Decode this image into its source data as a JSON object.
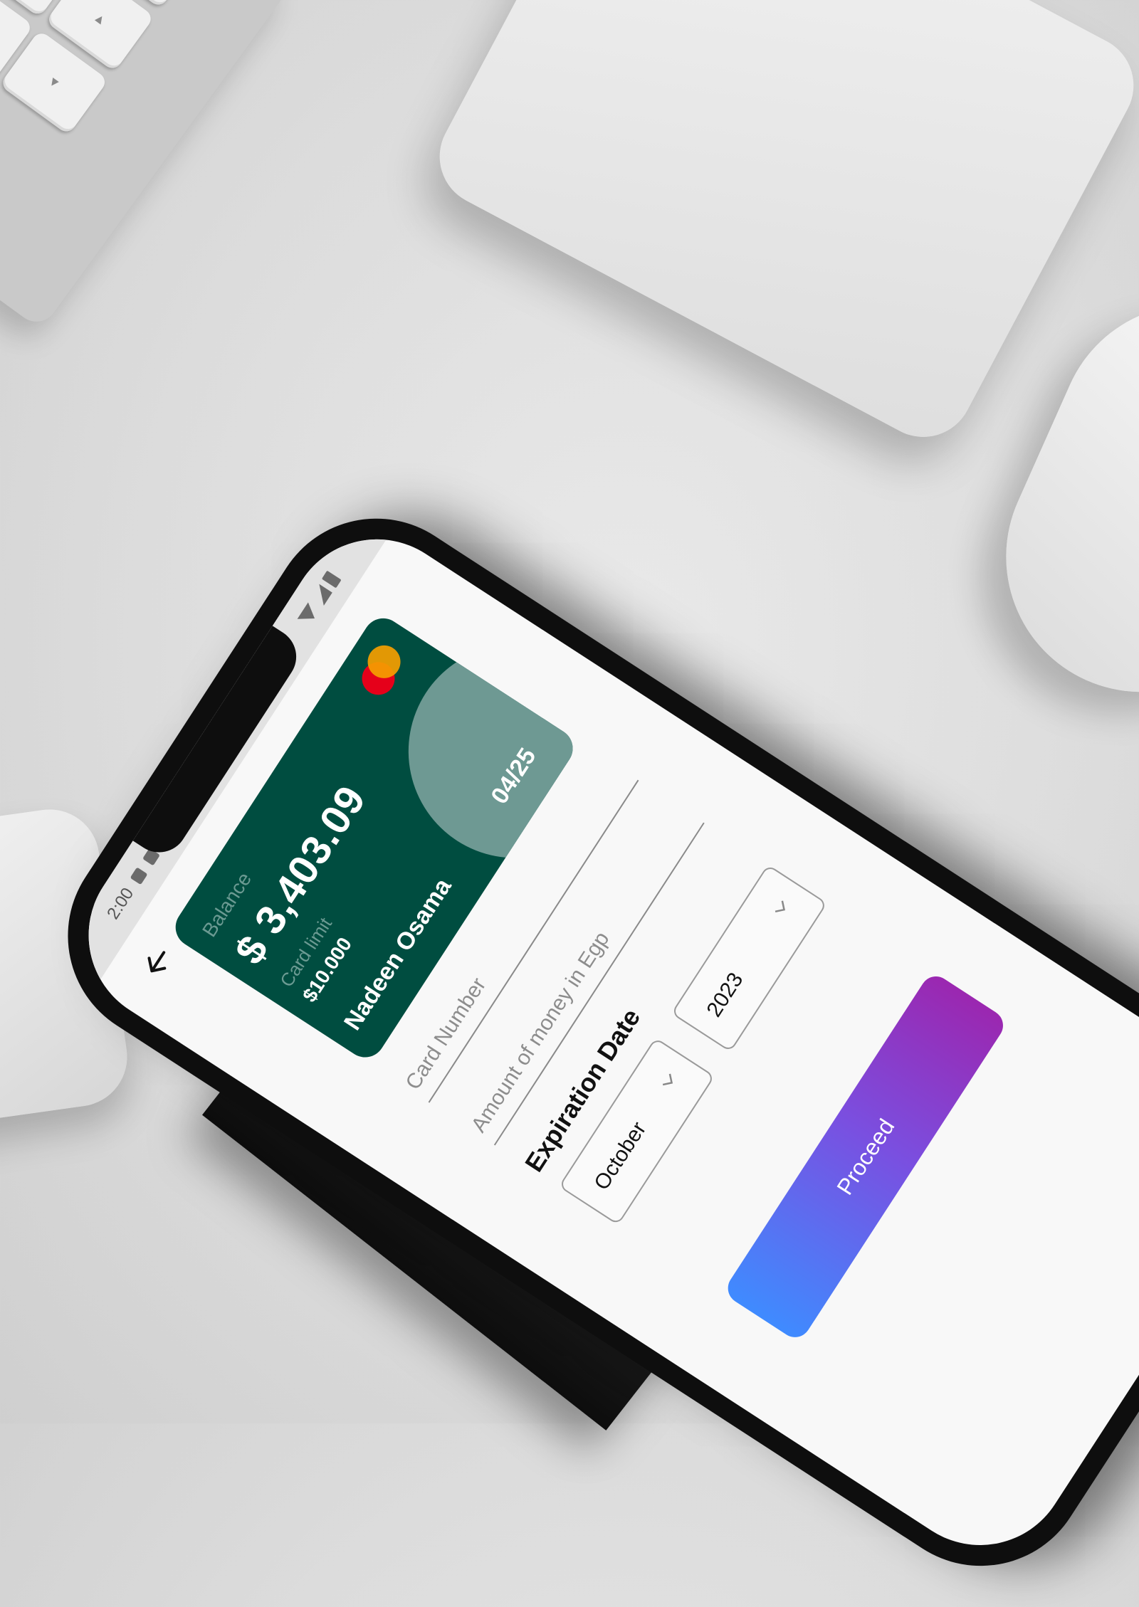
{
  "status_bar": {
    "time": "2:00"
  },
  "card": {
    "balance_label": "Balance",
    "balance": "$ 3,403.09",
    "limit_label": "Card limit",
    "limit": "$10.000",
    "holder": "Nadeen Osama",
    "expiry": "04/25"
  },
  "form": {
    "card_number_placeholder": "Card Number",
    "amount_placeholder": "Amount of money in Egp",
    "expiration_title": "Expiration Date",
    "month": "October",
    "year": "2023",
    "proceed_label": "Proceed"
  },
  "colors": {
    "card_background": "#004d40",
    "card_accent_circle": "#6e9993",
    "button_gradient_start": "#3f8bff",
    "button_gradient_end": "#9b27b0",
    "mastercard_red": "#e5001a",
    "mastercard_orange": "#f59e00"
  },
  "icons": {
    "back": "arrow-left-icon",
    "dropdown": "chevron-down-icon",
    "card_brand": "mastercard-logo-icon"
  }
}
